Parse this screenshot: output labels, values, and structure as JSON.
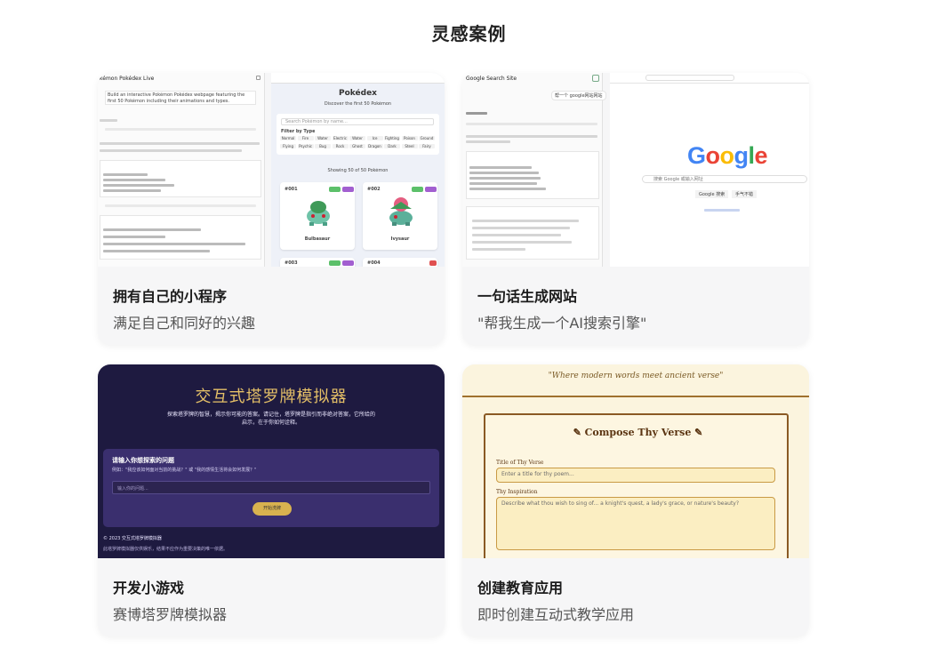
{
  "section_title": "灵感案例",
  "cards": [
    {
      "title": "拥有自己的小程序",
      "subtitle": "满足自己和同好的兴趣",
      "preview": {
        "left_header": "kémon Pokédex Live",
        "prompt_text": "Build an interactive Pokémon Pokédex webpage featuring the first 50 Pokémon including their animations and types.",
        "pokedex_title": "Pokédex",
        "pokedex_subtitle": "Discover the first 50 Pokémon",
        "search_placeholder": "Search Pokémon by name...",
        "filter_label": "Filter by Type",
        "types": [
          "Normal",
          "Fire",
          "Water",
          "Electric",
          "Water",
          "Ice",
          "Fighting",
          "Poison",
          "Ground",
          "Flying",
          "Psychic",
          "Bug",
          "Rock",
          "Ghost",
          "Dragon",
          "Dark",
          "Steel",
          "Fairy"
        ],
        "showing": "Showing 50 of 50 Pokémon",
        "pokemon": [
          {
            "num": "#001",
            "name": "Bulbasaur"
          },
          {
            "num": "#002",
            "name": "Ivysaur"
          },
          {
            "num": "#003",
            "name": ""
          },
          {
            "num": "#004",
            "name": ""
          }
        ]
      }
    },
    {
      "title": "一句话生成网站",
      "subtitle": "\"帮我生成一个AI搜索引擎\"",
      "preview": {
        "left_header": "Google Search Site",
        "chat_bubble": "帮一个 google网站网站",
        "google_logo": "Google",
        "google_placeholder": "搜索 Google 或输入网址",
        "btn_search": "Google 搜索",
        "btn_lucky": "手气不错"
      }
    },
    {
      "title": "开发小游戏",
      "subtitle": "赛博塔罗牌模拟器",
      "preview": {
        "game_title": "交互式塔罗牌模拟器",
        "intro": "探索塔罗牌的智慧，揭示你可能的答案。请记住，塔罗牌是指引而非绝对答案，它所给的启示，在于你如何诠释。",
        "question_label": "请输入你想探索的问题",
        "question_hint": "例如：\"我应该如何面对当前的挑战？\" 或 \"我的感情生活将会如何发展？\"",
        "input_placeholder": "输入你的问题...",
        "button": "开始洗牌",
        "footer": "© 2023 交互式塔罗牌模拟器",
        "disclaimer": "此塔罗牌模拟器仅供娱乐，结果不应作为重要决策的唯一依据。"
      }
    },
    {
      "title": "创建教育应用",
      "subtitle": "即时创建互动式教学应用",
      "preview": {
        "quote": "\"Where modern words meet ancient verse\"",
        "compose": "Compose Thy Verse",
        "title_label": "Title of Thy Verse",
        "title_placeholder": "Enter a title for thy poem...",
        "inspiration_label": "Thy Inspiration",
        "inspiration_placeholder": "Describe what thou wish to sing of... a knight's quest, a lady's grace, or nature's beauty?"
      }
    }
  ],
  "colors": {
    "card_bg": "#f6f6f7",
    "tarot_bg": "#1e1a40",
    "tarot_gold": "#e5c067",
    "parchment": "#fbf4de",
    "parchment_border": "#8a5a24"
  }
}
